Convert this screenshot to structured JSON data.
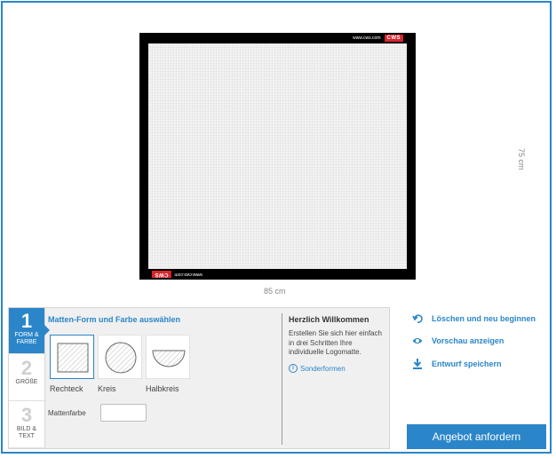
{
  "preview": {
    "width_label": "85 cm",
    "height_label": "75 cm",
    "brand_url": "www.cws.com",
    "brand_logo": "CWS"
  },
  "steps": [
    {
      "number": "1",
      "label_line1": "FORM &",
      "label_line2": "FARBE"
    },
    {
      "number": "2",
      "label_line1": "GRÖßE",
      "label_line2": ""
    },
    {
      "number": "3",
      "label_line1": "BILD &",
      "label_line2": "TEXT"
    }
  ],
  "form_section": {
    "title": "Matten-Form und Farbe auswählen",
    "shapes": [
      {
        "label": "Rechteck",
        "icon": "rectangle-shape-icon",
        "selected": true
      },
      {
        "label": "Kreis",
        "icon": "circle-shape-icon",
        "selected": false
      },
      {
        "label": "Halbkreis",
        "icon": "semicircle-shape-icon",
        "selected": false
      }
    ],
    "color_label": "Mattenfarbe",
    "color_value": "#ffffff"
  },
  "welcome": {
    "title": "Herzlich Willkommen",
    "text": "Erstellen Sie sich hier einfach in drei Schritten Ihre individuelle Logomatte.",
    "special_link": "Sonderformen",
    "special_icon": "info-icon"
  },
  "actions": [
    {
      "label": "Löschen und neu beginnen",
      "icon": "undo-icon"
    },
    {
      "label": "Vorschau anzeigen",
      "icon": "eye-icon"
    },
    {
      "label": "Entwurf speichern",
      "icon": "download-icon"
    }
  ],
  "cta_label": "Angebot anfordern",
  "colors": {
    "accent": "#2a86c8",
    "brand_red": "#d6262d"
  }
}
